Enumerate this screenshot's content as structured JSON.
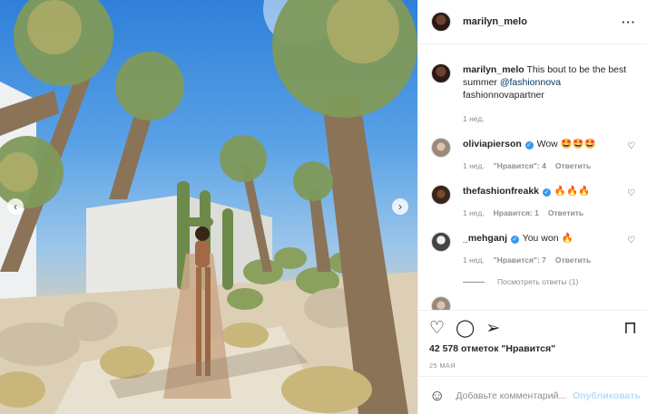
{
  "post": {
    "username": "marilyn_melo",
    "caption_text": "This bout to be the best summer",
    "caption_mention": "@fashionnova",
    "caption_tag": "fashionnovapartner",
    "caption_time": "1 нед."
  },
  "header": {
    "username": "marilyn_melo",
    "more_icon": "more-horizontal-icon"
  },
  "comments": [
    {
      "username": "oliviapierson",
      "verified": true,
      "text": "Wow 🤩🤩🤩",
      "time": "1 нед.",
      "likes": "\"Нравится\": 4",
      "reply": "Ответить"
    },
    {
      "username": "thefashionfreakk",
      "verified": true,
      "text": "🔥🔥🔥",
      "time": "1 нед.",
      "likes": "Нравится: 1",
      "reply": "Ответить"
    },
    {
      "username": "_mehganj",
      "verified": true,
      "text": "You won 🔥",
      "time": "1 нед.",
      "likes": "\"Нравится\": 7",
      "reply": "Ответить"
    }
  ],
  "view_replies": "Посмотреть ответы (1)",
  "likes_count": "42 578 отметок \"Нравится\"",
  "date": "25 МАЯ",
  "add_comment": {
    "placeholder": "Добавьте комментарий...",
    "publish": "Опубликовать"
  },
  "icons": {
    "like": "heart-icon",
    "comment": "comment-icon",
    "share": "share-icon",
    "save": "bookmark-icon",
    "emoji": "emoji-icon",
    "prev": "chevron-left-icon",
    "next": "chevron-right-icon"
  },
  "colors": {
    "verified": "#3897f0",
    "link": "#00376b",
    "publish": "#b2dffc",
    "muted": "#8e8e8e"
  }
}
